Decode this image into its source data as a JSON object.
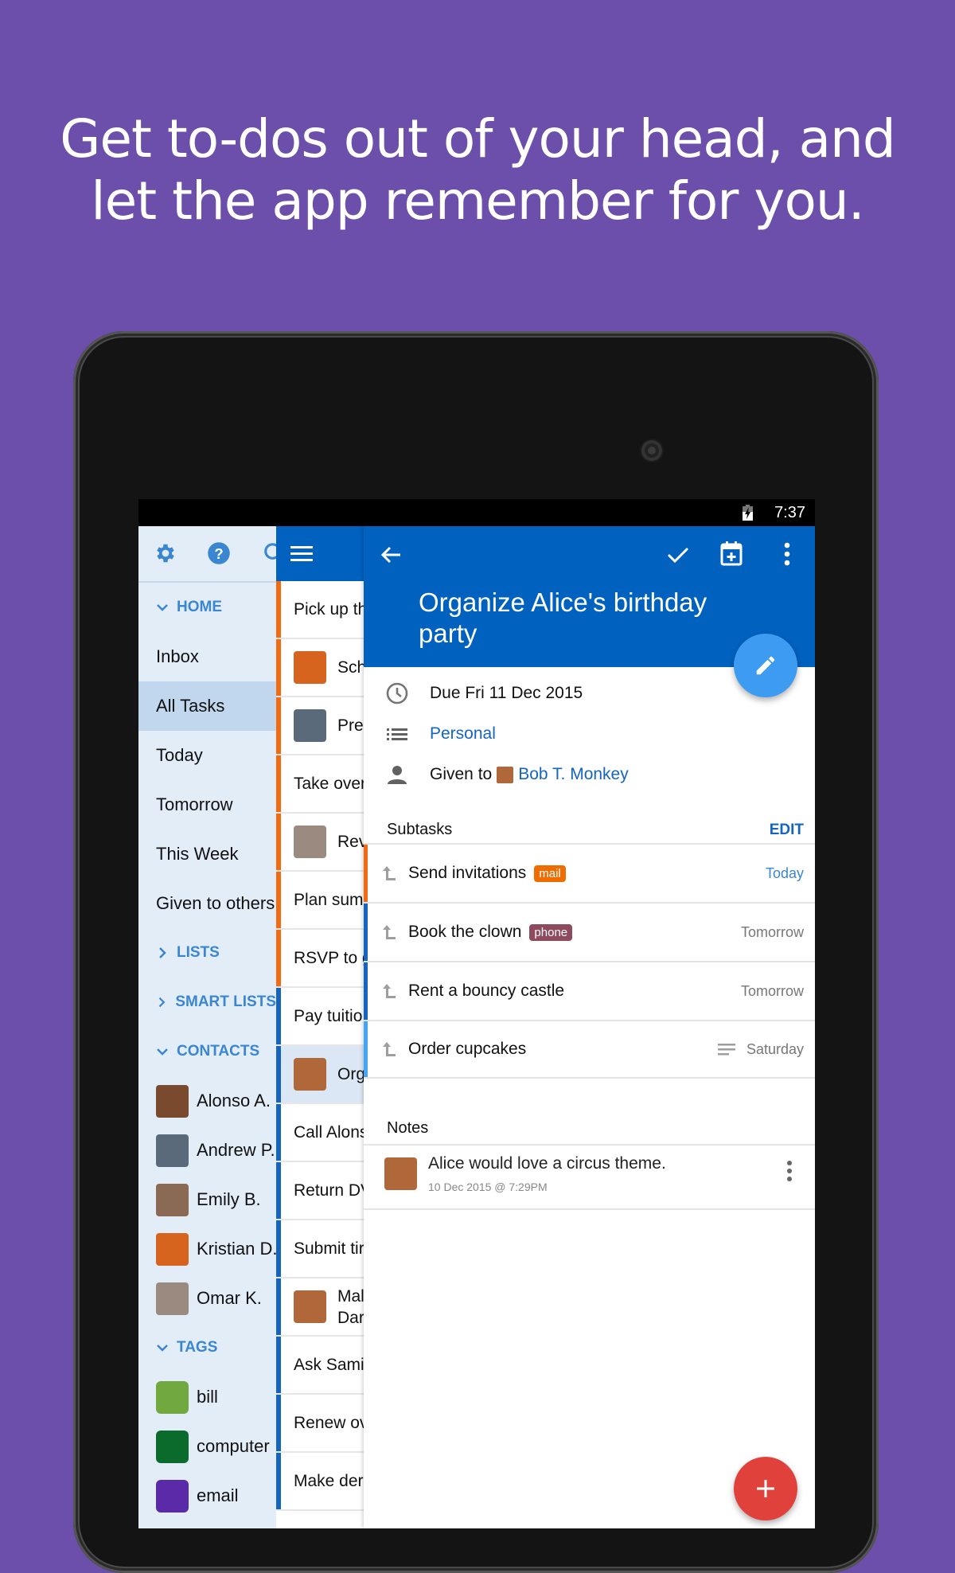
{
  "headline": {
    "line1": "Get to-dos out of your head, and",
    "line2": "let the app remember for you."
  },
  "colors": {
    "background": "#6b4faa",
    "app_blue": "#0061bf",
    "accent_orange": "#f46a10",
    "link_blue": "#1565c0",
    "fab_edit": "#3d9bf2",
    "fab_add": "#e0413a"
  },
  "status_bar": {
    "time": "7:37",
    "battery_icon": "battery-charging-icon"
  },
  "sidebar": {
    "icons": [
      "gear-icon",
      "help-icon",
      "search-icon"
    ],
    "home_header": "HOME",
    "home_items": [
      {
        "label": "Inbox",
        "active": false
      },
      {
        "label": "All Tasks",
        "active": true
      },
      {
        "label": "Today",
        "active": false
      },
      {
        "label": "Tomorrow",
        "active": false
      },
      {
        "label": "This Week",
        "active": false
      },
      {
        "label": "Given to others",
        "active": false
      }
    ],
    "lists_header": "LISTS",
    "smart_lists_header": "SMART LISTS",
    "contacts_header": "CONTACTS",
    "contacts": [
      {
        "name": "Alonso A.",
        "avatar_color": "#7a4a2e"
      },
      {
        "name": "Andrew P.",
        "avatar_color": "#5b6a7a"
      },
      {
        "name": "Emily B.",
        "avatar_color": "#8a6a55"
      },
      {
        "name": "Kristian D.",
        "avatar_color": "#d7641e"
      },
      {
        "name": "Omar K.",
        "avatar_color": "#9a8a80"
      }
    ],
    "tags_header": "TAGS",
    "tags": [
      {
        "name": "bill",
        "color": "#72a840"
      },
      {
        "name": "computer",
        "color": "#0b6b2c"
      },
      {
        "name": "email",
        "color": "#5a2aa8"
      }
    ]
  },
  "task_list": {
    "menu_icon": "hamburger-menu-icon",
    "tasks": [
      {
        "text": "Pick up th",
        "bar": "#f46a10",
        "avatar": null
      },
      {
        "text": "Sch",
        "bar": "#f46a10",
        "avatar": "#d7641e"
      },
      {
        "text": "Pre",
        "bar": "#f46a10",
        "avatar": "#5b6a7a"
      },
      {
        "text": "Take over",
        "bar": "#f46a10",
        "avatar": null
      },
      {
        "text": "Rev",
        "bar": "#f46a10",
        "avatar": "#9a8a80"
      },
      {
        "text": "Plan sum",
        "bar": "#f46a10",
        "avatar": null
      },
      {
        "text": "RSVP to g",
        "bar": "#f46a10",
        "avatar": null
      },
      {
        "text": "Pay tuitio",
        "bar": "#1565c0",
        "avatar": null
      },
      {
        "text": "Org",
        "bar": "#1565c0",
        "avatar": "#b0683a",
        "selected": true
      },
      {
        "text": "Call Alons",
        "bar": "#1565c0",
        "avatar": null
      },
      {
        "text": "Return DV",
        "bar": "#1565c0",
        "avatar": null
      },
      {
        "text": "Submit tir",
        "bar": "#1565c0",
        "avatar": null
      },
      {
        "text": "Mal",
        "text2": "Dar",
        "bar": "#1565c0",
        "avatar": "#b0683a"
      },
      {
        "text": "Ask Sami",
        "bar": "#1565c0",
        "avatar": null
      },
      {
        "text": "Renew ov",
        "bar": "#1565c0",
        "avatar": null
      },
      {
        "text": "Make der",
        "bar": "#1565c0",
        "avatar": null
      }
    ]
  },
  "detail": {
    "toolbar_icons": [
      "back-arrow-icon",
      "check-icon",
      "calendar-add-icon",
      "more-vert-icon"
    ],
    "title": "Organize Alice's birthday party",
    "due": "Due Fri 11 Dec 2015",
    "list": "Personal",
    "given_to_label": "Given to",
    "given_to_name": "Bob T. Monkey",
    "subtasks_label": "Subtasks",
    "edit_label": "EDIT",
    "subtasks": [
      {
        "text": "Send invitations",
        "badge": "mail",
        "badge_color": "#ef6c00",
        "due": "Today",
        "due_today": true,
        "has_note": false,
        "bar": "#f46a10"
      },
      {
        "text": "Book the clown",
        "badge": "phone",
        "badge_color": "#8e4a5e",
        "due": "Tomorrow",
        "due_today": false,
        "has_note": false,
        "bar": "#1565c0"
      },
      {
        "text": "Rent a bouncy castle",
        "badge": null,
        "due": "Tomorrow",
        "due_today": false,
        "has_note": false,
        "bar": "#1565c0"
      },
      {
        "text": "Order cupcakes",
        "badge": null,
        "due": "Saturday",
        "due_today": false,
        "has_note": true,
        "bar": "#42a5f5"
      }
    ],
    "notes_label": "Notes",
    "note": {
      "text": "Alice would love a circus theme.",
      "timestamp": "10 Dec 2015 @ 7:29PM"
    }
  }
}
